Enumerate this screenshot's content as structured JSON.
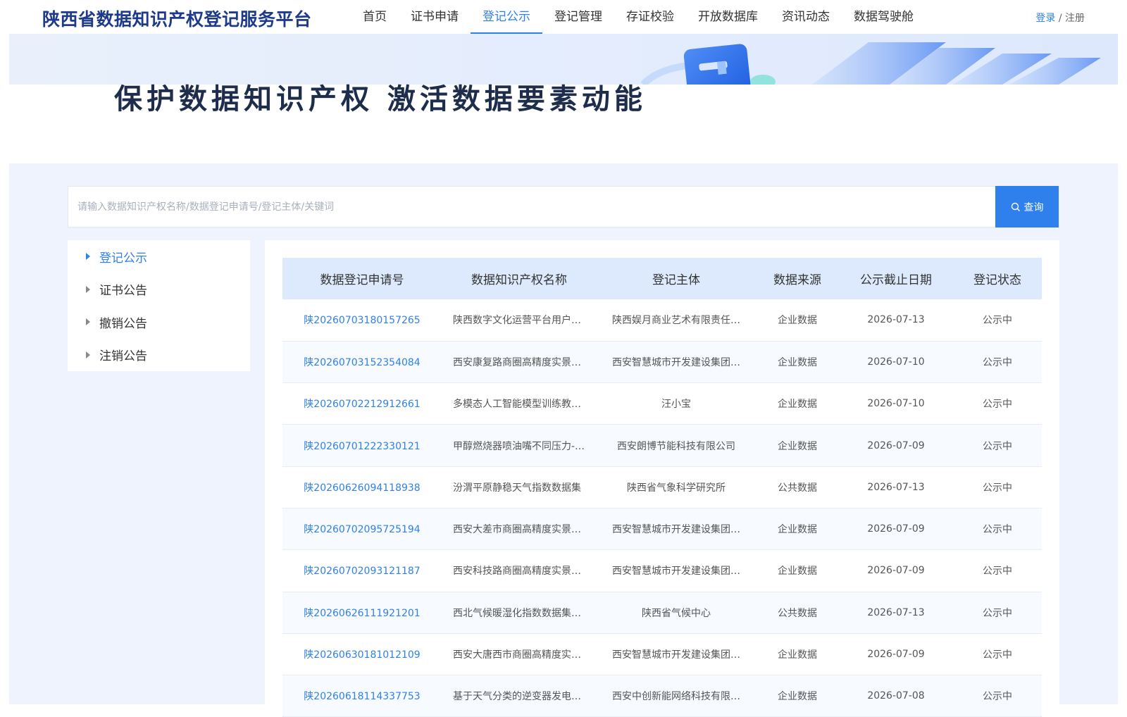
{
  "header": {
    "logo": "陕西省数据知识产权登记服务平台",
    "nav": [
      "首页",
      "证书申请",
      "登记公示",
      "登记管理",
      "存证校验",
      "开放数据库",
      "资讯动态",
      "数据驾驶舱"
    ],
    "active_nav": "登记公示",
    "login": "登录",
    "separator": " / ",
    "register": "注册"
  },
  "banner": {
    "slogan": "保护数据知识产权 激活数据要素动能"
  },
  "search": {
    "placeholder": "请输入数据知识产权名称/数据登记申请号/登记主体/关键词",
    "button": "查询"
  },
  "sidebar": {
    "items": [
      "登记公示",
      "证书公告",
      "撤销公告",
      "注销公告"
    ],
    "active": "登记公示"
  },
  "table": {
    "headers": [
      "数据登记申请号",
      "数据知识产权名称",
      "登记主体",
      "数据来源",
      "公示截止日期",
      "登记状态"
    ],
    "rows": [
      [
        "陕20260703180157265",
        "陕西数字文化运营平台用户…",
        "陕西娱月商业艺术有限责任…",
        "企业数据",
        "2026-07-13",
        "公示中"
      ],
      [
        "陕20260703152354084",
        "西安康复路商圈高精度实景…",
        "西安智慧城市开发建设集团…",
        "企业数据",
        "2026-07-10",
        "公示中"
      ],
      [
        "陕20260702212912661",
        "多模态人工智能模型训练教…",
        "汪小宝",
        "企业数据",
        "2026-07-10",
        "公示中"
      ],
      [
        "陕20260701222330121",
        "甲醇燃烧器喷油嘴不同压力-…",
        "西安朗博节能科技有限公司",
        "企业数据",
        "2026-07-09",
        "公示中"
      ],
      [
        "陕20260626094118938",
        "汾渭平原静稳天气指数数据集",
        "陕西省气象科学研究所",
        "公共数据",
        "2026-07-13",
        "公示中"
      ],
      [
        "陕20260702095725194",
        "西安大差市商圈高精度实景…",
        "西安智慧城市开发建设集团…",
        "企业数据",
        "2026-07-09",
        "公示中"
      ],
      [
        "陕20260702093121187",
        "西安科技路商圈高精度实景…",
        "西安智慧城市开发建设集团…",
        "企业数据",
        "2026-07-09",
        "公示中"
      ],
      [
        "陕20260626111921201",
        "西北气候暖湿化指数数据集…",
        "陕西省气候中心",
        "公共数据",
        "2026-07-13",
        "公示中"
      ],
      [
        "陕20260630181012109",
        "西安大唐西市商圈高精度实…",
        "西安智慧城市开发建设集团…",
        "企业数据",
        "2026-07-09",
        "公示中"
      ],
      [
        "陕20260618114337753",
        "基于天气分类的逆变器发电…",
        "西安中创新能网络科技有限…",
        "企业数据",
        "2026-07-08",
        "公示中"
      ]
    ]
  },
  "colors": {
    "accent": "#2f80ed",
    "logo": "#1e3a8a",
    "header_row": "#dde9fc",
    "page_bg": "#eef3fd"
  }
}
